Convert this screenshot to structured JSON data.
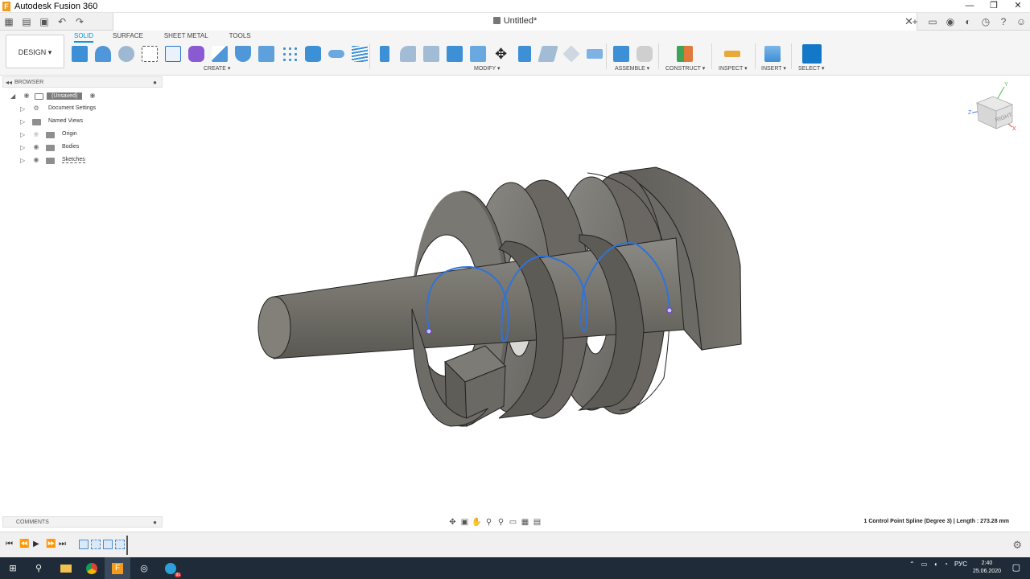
{
  "window": {
    "app_icon": "F",
    "title": "Autodesk Fusion 360",
    "controls": [
      "—",
      "❐",
      "✕"
    ]
  },
  "tabbar": {
    "doc_title": "Untitled*",
    "close": "✕",
    "left_icons": [
      "grid-icon",
      "file-icon",
      "save-icon",
      "undo-icon",
      "redo-icon"
    ],
    "right_icons": [
      "plus-icon",
      "job-status-icon",
      "extensions-icon",
      "history-icon",
      "clock-icon",
      "help-icon",
      "account-icon"
    ]
  },
  "ribbon": {
    "workspace": "DESIGN ▾",
    "tabs": [
      "SOLID",
      "SURFACE",
      "SHEET METAL",
      "TOOLS"
    ],
    "active_tab": "SOLID",
    "groups": {
      "create": "CREATE ▾",
      "modify": "MODIFY ▾",
      "assemble": "ASSEMBLE ▾",
      "construct": "CONSTRUCT ▾",
      "inspect": "INSPECT ▾",
      "insert": "INSERT ▾",
      "select": "SELECT ▾"
    }
  },
  "browser": {
    "title": "BROWSER",
    "root": "(Unsaved)",
    "items": [
      "Document Settings",
      "Named Views",
      "Origin",
      "Bodies",
      "Sketches"
    ]
  },
  "viewcube": {
    "face": "RIGHT",
    "axes": [
      "Y",
      "Z",
      "X"
    ]
  },
  "comments": {
    "title": "COMMENTS"
  },
  "status": {
    "selection": "1 Control Point Spline (Degree 3) | Length : 273.28 mm"
  },
  "taskbar": {
    "lang": "РУС",
    "time": "2:40",
    "date": "25.06.2020",
    "telegram_badge": "91"
  },
  "colors": {
    "accent": "#0696d7",
    "spline": "#2f73d8",
    "body": "#6f6c66",
    "taskbar": "#1f2b38"
  }
}
